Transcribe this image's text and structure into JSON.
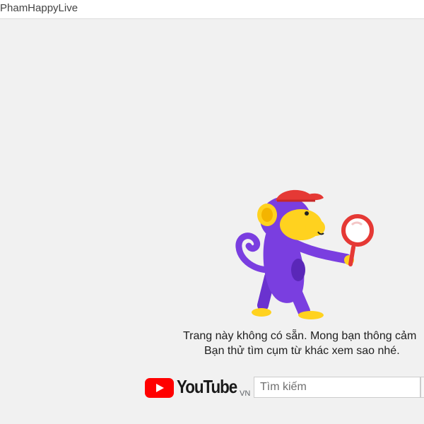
{
  "window": {
    "title": "PhamHappyLive"
  },
  "error": {
    "line1": "Trang này không có sẵn. Mong bạn thông cảm",
    "line2": "Bạn thử tìm cụm từ khác xem sao nhé.",
    "illustration": "monkey-with-magnifier"
  },
  "logo": {
    "wordmark": "YouTube",
    "country": "VN"
  },
  "search": {
    "placeholder": "Tìm kiếm",
    "value": ""
  },
  "colors": {
    "brand_red": "#ff0000",
    "background": "#f1f1f1",
    "monkey_purple": "#7a3ee0",
    "monkey_yellow": "#ffd21f",
    "cap_red": "#e53935"
  }
}
